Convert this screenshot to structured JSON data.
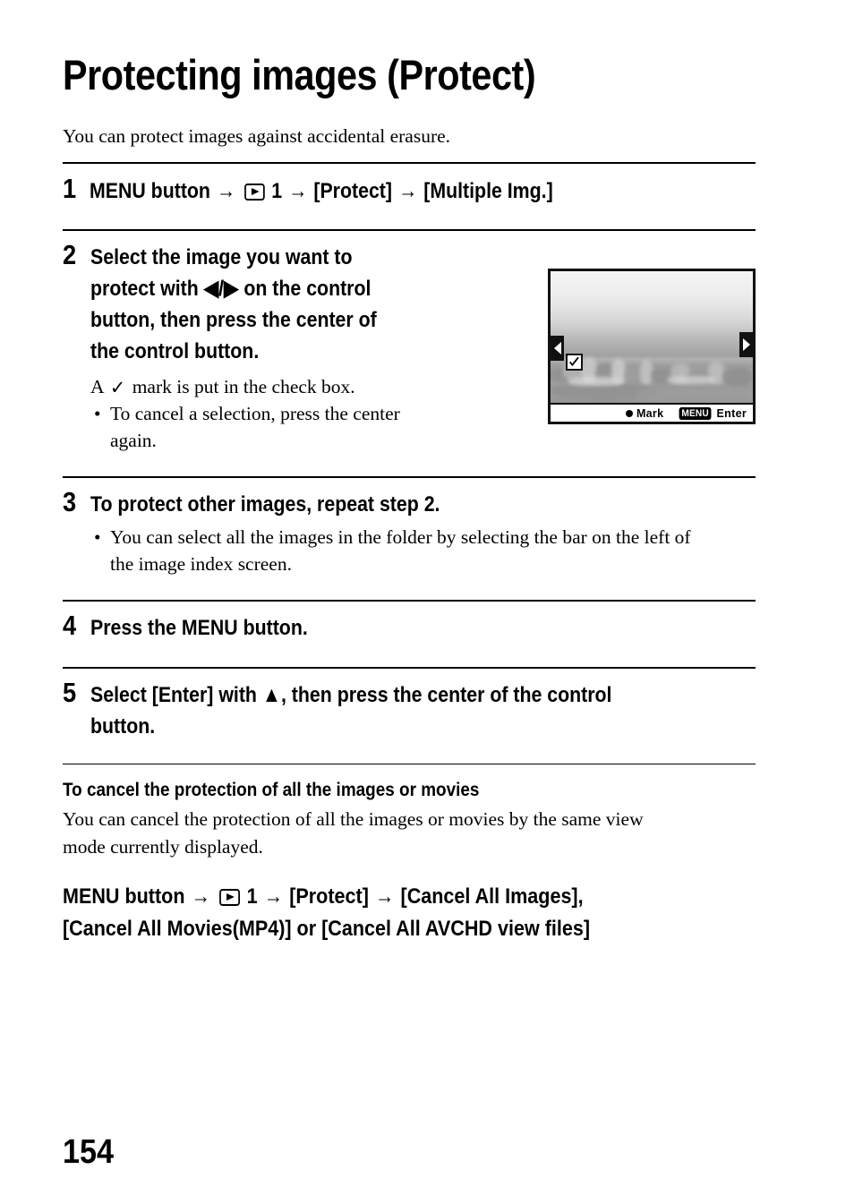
{
  "document": {
    "title": "Protecting images (Protect)",
    "intro": "You can protect images against accidental erasure.",
    "page_number": "154"
  },
  "steps": [
    {
      "number": "1",
      "heading_parts": {
        "prefix": "MENU button",
        "arrow1": "→",
        "icon": "playback-icon",
        "menu_tab": "1",
        "arrow2": "→",
        "item1": "[Protect]",
        "arrow3": "→",
        "item2": "[Multiple Img.]"
      }
    },
    {
      "number": "2",
      "heading_lines": [
        "Select the image you want to",
        "protect with ◀/▶ on the control",
        "button, then press the center of",
        "the control button."
      ],
      "notes": {
        "note_prefix": "A",
        "note_glyph": "✓",
        "note_suffix": "mark is put in the check box.",
        "bullet_lines": [
          "To cancel a selection, press the center",
          "again."
        ]
      }
    },
    {
      "number": "3",
      "heading": "To protect other images, repeat step 2.",
      "bullet_lines": [
        "You can select all the images in the folder by selecting the bar on the left of",
        "the image index screen."
      ]
    },
    {
      "number": "4",
      "heading": "Press the MENU button."
    },
    {
      "number": "5",
      "heading_lines": [
        "Select [Enter] with ▲, then press the center of the control",
        "button."
      ]
    }
  ],
  "lcd_screen": {
    "bar": {
      "mark_dot": "●",
      "mark_label": "Mark",
      "menu_chip": "MENU",
      "enter_label": "Enter"
    },
    "left_arrow": "◀",
    "right_arrow": "▶",
    "checkbox_state": "checked"
  },
  "cancel_section": {
    "heading": "To cancel the protection of all the images or movies",
    "body_lines": [
      "You can cancel the protection of all the images or movies by the same view",
      "mode currently displayed."
    ],
    "menu_path": {
      "prefix": "MENU button",
      "arrow1": "→",
      "icon": "playback-icon",
      "menu_tab": "1",
      "arrow2": "→",
      "item1": "[Protect]",
      "arrow3": "→",
      "item2": "[Cancel All Images],",
      "line2": "[Cancel All Movies(MP4)] or [Cancel All AVCHD view files]"
    }
  },
  "colors": {
    "text": "#000000",
    "background": "#ffffff",
    "rule": "#000000"
  }
}
